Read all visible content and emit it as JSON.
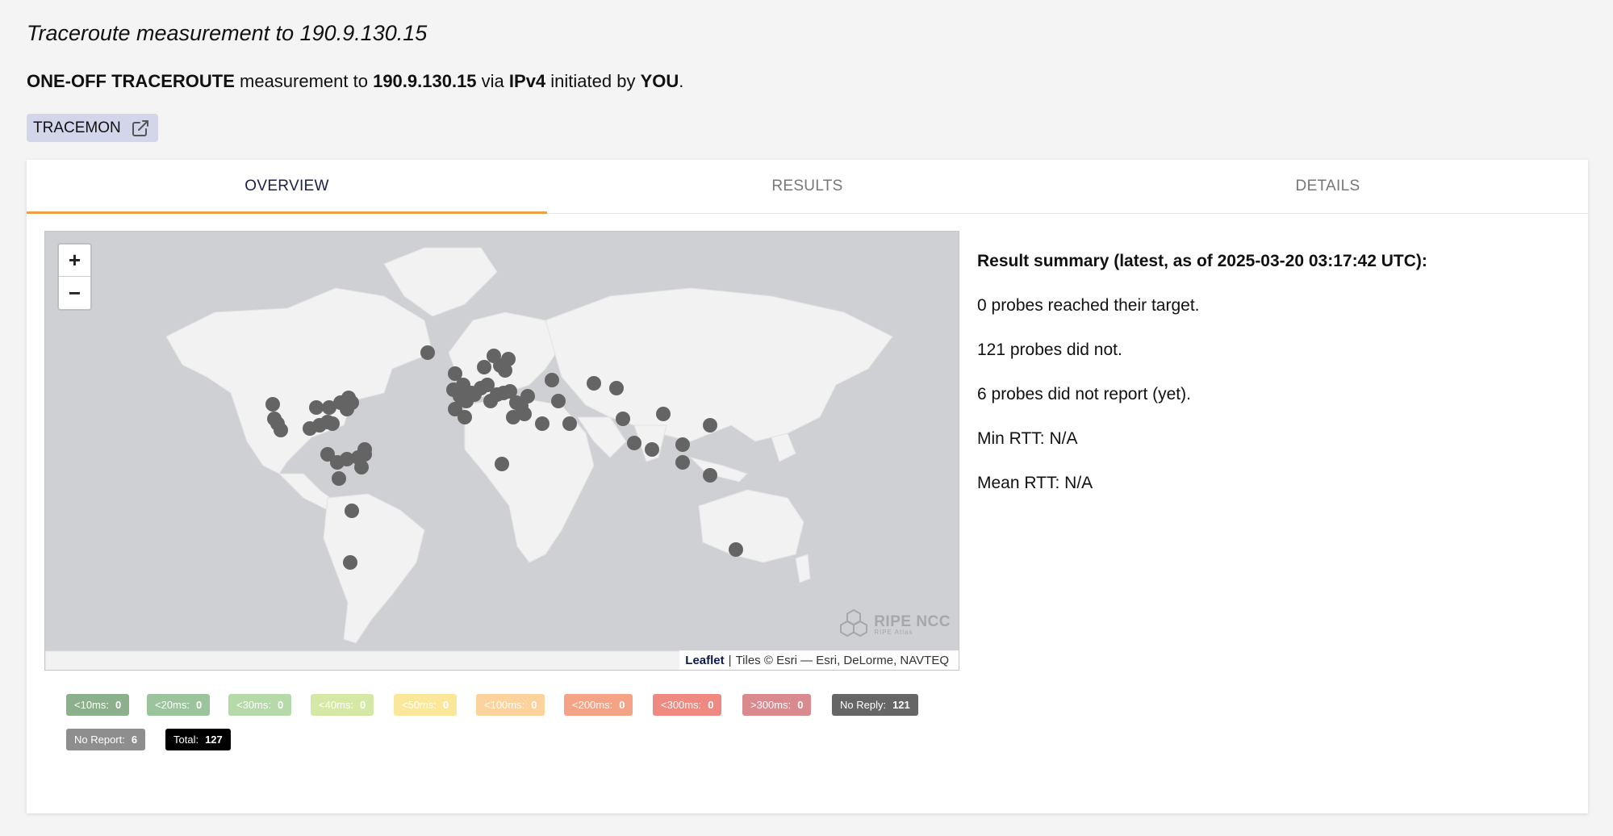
{
  "page": {
    "title": "Traceroute measurement to 190.9.130.15",
    "subtitle": {
      "type": "ONE-OFF TRACEROUTE",
      "text_measurement_to": " measurement to ",
      "target": "190.9.130.15",
      "text_via": " via ",
      "protocol": "IPv4",
      "text_initiated_by": " initiated by ",
      "initiator": "YOU",
      "end": "."
    },
    "tracemon_label": "TRACEMON"
  },
  "tabs": [
    {
      "label": "OVERVIEW",
      "active": true
    },
    {
      "label": "RESULTS",
      "active": false
    },
    {
      "label": "DETAILS",
      "active": false
    }
  ],
  "map": {
    "zoom_in": "+",
    "zoom_out": "−",
    "watermark": {
      "name": "RIPE NCC",
      "sub": "RIPE Atlas"
    },
    "attribution": {
      "leaflet": "Leaflet",
      "separator": "|",
      "tiles": "Tiles © Esri — Esri, DeLorme, NAVTEQ"
    },
    "probe_color": "#646464"
  },
  "summary": {
    "title": "Result summary (latest, as of 2025-03-20 03:17:42 UTC):",
    "reached": "0 probes reached their target.",
    "not_reached": "121 probes did not.",
    "no_report": "6 probes did not report (yet).",
    "min_rtt": "Min RTT: N/A",
    "mean_rtt": "Mean RTT: N/A"
  },
  "legend": [
    {
      "label": "<10ms:",
      "count": "0",
      "color": "#8bb08b"
    },
    {
      "label": "<20ms:",
      "count": "0",
      "color": "#9cc49c"
    },
    {
      "label": "<30ms:",
      "count": "0",
      "color": "#b5d9a8"
    },
    {
      "label": "<40ms:",
      "count": "0",
      "color": "#d5e8a5"
    },
    {
      "label": "<50ms:",
      "count": "0",
      "color": "#fbe79a"
    },
    {
      "label": "<100ms:",
      "count": "0",
      "color": "#fcd39c"
    },
    {
      "label": "<200ms:",
      "count": "0",
      "color": "#f5a386"
    },
    {
      "label": "<300ms:",
      "count": "0",
      "color": "#ee8a82"
    },
    {
      "label": ">300ms:",
      "count": "0",
      "color": "#d98a8f"
    },
    {
      "label": "No Reply:",
      "count": "121",
      "color": "#666666"
    },
    {
      "label": "No Report:",
      "count": "6",
      "color": "#8e8e8e"
    },
    {
      "label": "Total:",
      "count": "127",
      "color": "#000000"
    }
  ]
}
